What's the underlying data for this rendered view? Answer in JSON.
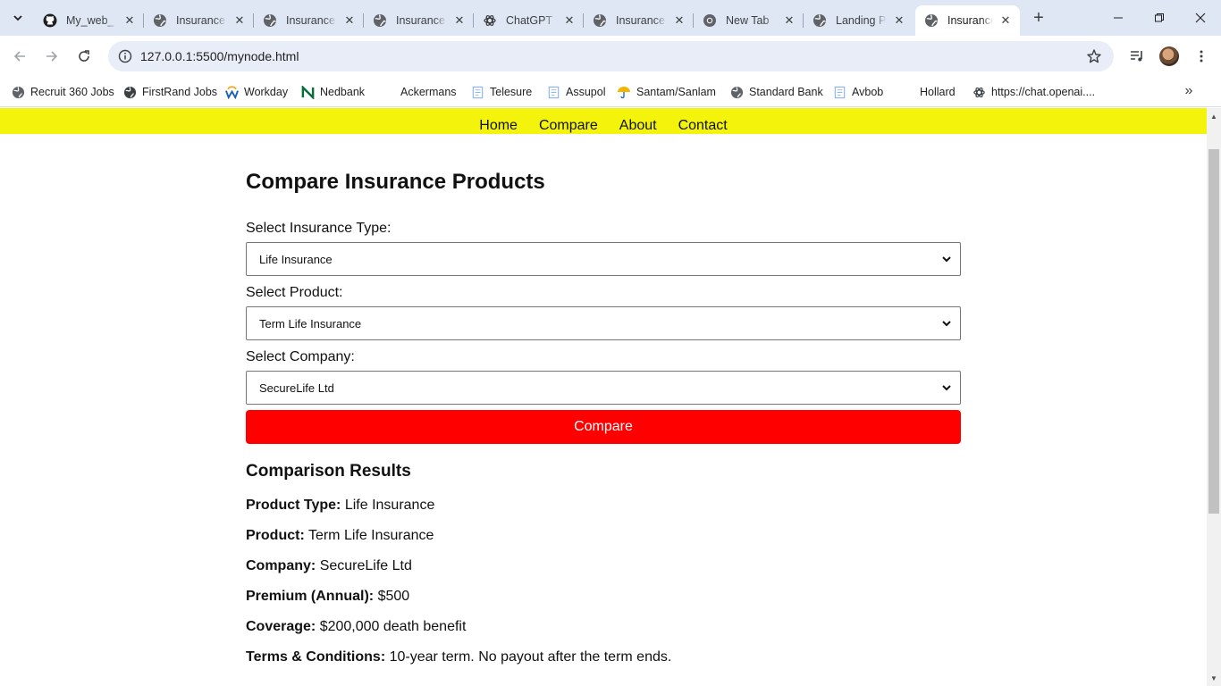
{
  "browser": {
    "tabs": [
      {
        "title": "My_web_",
        "icon": "github-icon",
        "active": false
      },
      {
        "title": "Insurance",
        "icon": "globe-icon",
        "active": false
      },
      {
        "title": "Insurance",
        "icon": "globe-icon",
        "active": false
      },
      {
        "title": "Insurance",
        "icon": "globe-icon",
        "active": false
      },
      {
        "title": "ChatGPT",
        "icon": "openai-icon",
        "active": false
      },
      {
        "title": "Insurance",
        "icon": "globe-icon",
        "active": false
      },
      {
        "title": "New Tab",
        "icon": "chrome-icon",
        "active": false
      },
      {
        "title": "Landing P",
        "icon": "globe-icon",
        "active": false
      },
      {
        "title": "Insurance",
        "icon": "globe-icon",
        "active": true
      }
    ],
    "url": "127.0.0.1:5500/mynode.html",
    "bookmarks": [
      {
        "label": "Recruit 360 Jobs",
        "icon": "globe-icon"
      },
      {
        "label": "FirstRand Jobs",
        "icon": "globe-icon"
      },
      {
        "label": "Workday",
        "icon": "workday-icon"
      },
      {
        "label": "Nedbank",
        "icon": "nedbank-icon"
      },
      {
        "label": "Ackermans",
        "icon": "blank-icon"
      },
      {
        "label": "Telesure",
        "icon": "page-icon"
      },
      {
        "label": "Assupol",
        "icon": "page-icon"
      },
      {
        "label": "Santam/Sanlam",
        "icon": "umbrella-icon"
      },
      {
        "label": "Standard Bank",
        "icon": "globe-icon"
      },
      {
        "label": "Avbob",
        "icon": "page-icon"
      },
      {
        "label": "Hollard",
        "icon": "blank-icon"
      },
      {
        "label": "https://chat.openai....",
        "icon": "openai-icon"
      }
    ]
  },
  "site": {
    "nav": [
      "Home",
      "Compare",
      "About",
      "Contact"
    ],
    "nav_bg": "#f3f30c",
    "title": "Compare Insurance Products",
    "type_label": "Select Insurance Type:",
    "type_value": "Life Insurance",
    "product_label": "Select Product:",
    "product_value": "Term Life Insurance",
    "company_label": "Select Company:",
    "company_value": "SecureLife Ltd",
    "compare_button": "Compare",
    "compare_color": "#ff0000",
    "results_title": "Comparison Results",
    "results": [
      {
        "label": "Product Type:",
        "value": "Life Insurance"
      },
      {
        "label": "Product:",
        "value": "Term Life Insurance"
      },
      {
        "label": "Company:",
        "value": "SecureLife Ltd"
      },
      {
        "label": "Premium (Annual):",
        "value": "$500"
      },
      {
        "label": "Coverage:",
        "value": "$200,000 death benefit"
      },
      {
        "label": "Terms & Conditions:",
        "value": "10-year term. No payout after the term ends."
      }
    ]
  }
}
